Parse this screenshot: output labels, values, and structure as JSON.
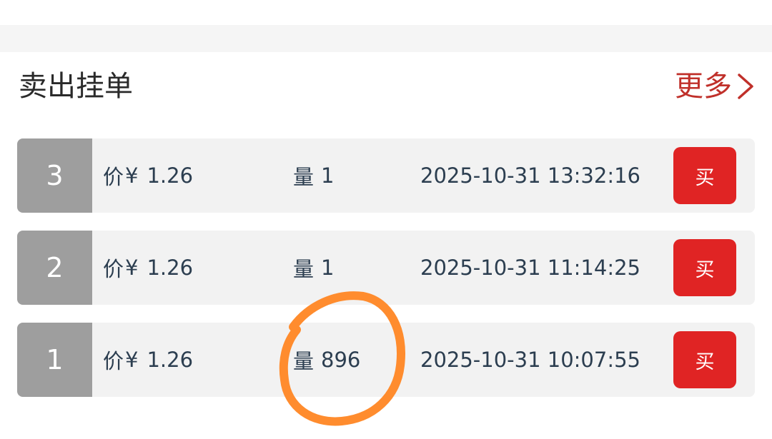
{
  "section": {
    "title": "卖出挂单",
    "more_label": "更多"
  },
  "orders": [
    {
      "rank": "3",
      "price_label": "价",
      "currency": "¥",
      "price": "1.26",
      "qty_label": "量",
      "qty": "1",
      "time": "2025-10-31 13:32:16",
      "buy_label": "买"
    },
    {
      "rank": "2",
      "price_label": "价",
      "currency": "¥",
      "price": "1.26",
      "qty_label": "量",
      "qty": "1",
      "time": "2025-10-31 11:14:25",
      "buy_label": "买"
    },
    {
      "rank": "1",
      "price_label": "价",
      "currency": "¥",
      "price": "1.26",
      "qty_label": "量",
      "qty": "896",
      "time": "2025-10-31 10:07:55",
      "buy_label": "买"
    }
  ],
  "colors": {
    "accent_red": "#e02424",
    "more_link_red": "#c0302a",
    "rank_gray": "#9e9e9e",
    "row_background": "#f2f2f2",
    "annotation_orange": "#ff8c2e"
  },
  "icons": {
    "more": "chevron-right-icon"
  }
}
